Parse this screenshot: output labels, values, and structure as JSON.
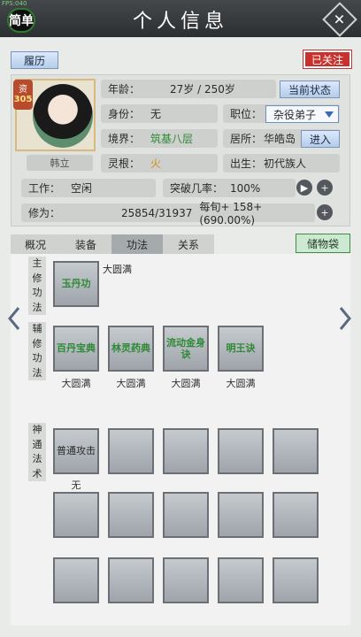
{
  "header": {
    "fps": "FPS:040",
    "mode_label": "简单",
    "title": "个人信息"
  },
  "buttons": {
    "resume": "履历",
    "followed": "已关注",
    "current_state": "当前状态",
    "enter": "进入",
    "storage": "储物袋"
  },
  "character": {
    "aptitude_label": "资",
    "aptitude_value": "305",
    "name": "韩立",
    "age_label": "年龄：",
    "age_value": "27岁 / 250岁",
    "identity_label": "身份：",
    "identity_value": "无",
    "position_label": "职位：",
    "position_value": "杂役弟子",
    "realm_label": "境界：",
    "realm_value": "筑基八层",
    "residence_label": "居所：",
    "residence_value": "华皓岛",
    "root_label": "灵根：",
    "root_value": "火",
    "origin_label": "出生：",
    "origin_value": "初代族人",
    "work_label": "工作：",
    "work_value": "空闲",
    "breakthrough_label": "突破几率：",
    "breakthrough_value": "100%",
    "cultivation_label": "修为：",
    "cultivation_value": "25854/31937",
    "cultivation_rate": "每旬+ 158+(690.00%)"
  },
  "tabs": [
    "概况",
    "装备",
    "功法",
    "关系"
  ],
  "techniques": {
    "main_label": [
      "主",
      "修",
      "功",
      "法"
    ],
    "main": {
      "name": "玉丹功",
      "level": "大圆满"
    },
    "aux_label": [
      "辅",
      "修",
      "功",
      "法"
    ],
    "aux": [
      {
        "name": "百丹宝典",
        "level": "大圆满"
      },
      {
        "name": "林灵药典",
        "level": "大圆满"
      },
      {
        "name": "流动金身诀",
        "level": "大圆满"
      },
      {
        "name": "明王诀",
        "level": "大圆满"
      }
    ],
    "divine_label": [
      "神",
      "通",
      "法",
      "术"
    ],
    "divine_first": {
      "name": "普通攻击",
      "level": "无"
    }
  },
  "colors": {
    "realm": "#2f8a36",
    "root": "#d68b12",
    "followed": "#c8312c"
  }
}
